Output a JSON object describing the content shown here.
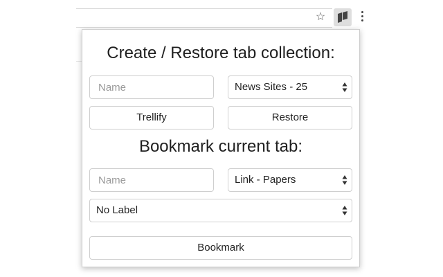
{
  "toolbar": {
    "star_icon": "star-icon",
    "extension_icon": "trello-extension-icon",
    "menu_icon": "kebab-menu-icon"
  },
  "popup": {
    "collection_heading": "Create / Restore tab collection:",
    "collection_name_placeholder": "Name",
    "collection_select_value": "News Sites - 25",
    "trellify_label": "Trellify",
    "restore_label": "Restore",
    "bookmark_heading": "Bookmark current tab:",
    "bookmark_name_placeholder": "Name",
    "bookmark_list_value": "Link - Papers",
    "label_select_value": "No Label",
    "bookmark_label": "Bookmark"
  },
  "colors": {
    "border": "#cfcfcf",
    "text": "#222222",
    "placeholder": "#9a9a9a"
  }
}
